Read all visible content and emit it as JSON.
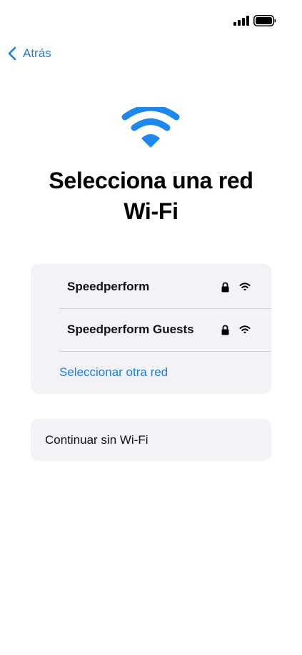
{
  "back": {
    "label": "Atrás"
  },
  "title": "Selecciona una red Wi-Fi",
  "networks": [
    {
      "name": "Speedperform"
    },
    {
      "name": "Speedperform Guests"
    }
  ],
  "other_network_label": "Seleccionar otra red",
  "continue_label": "Continuar sin Wi-Fi",
  "icons": {
    "status_signal": "cellular-signal-icon",
    "status_battery": "battery-icon",
    "back": "chevron-left-icon",
    "hero": "wifi-icon",
    "lock": "lock-icon",
    "network_signal": "wifi-signal-icon"
  },
  "colors": {
    "accent": "#1a7fe0",
    "hero_icon": "#1e88ec",
    "card_background": "#f2f2f7",
    "separator": "#d4d4d8"
  }
}
